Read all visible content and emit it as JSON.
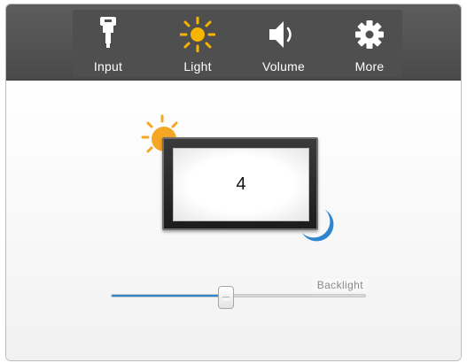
{
  "tabs": [
    {
      "label": "Input",
      "icon": "input-plug-icon"
    },
    {
      "label": "Light",
      "icon": "sun-icon"
    },
    {
      "label": "Volume",
      "icon": "speaker-icon"
    },
    {
      "label": "More",
      "icon": "gear-icon"
    }
  ],
  "active_tab": "Light",
  "monitor": {
    "value": "4"
  },
  "slider": {
    "label": "Backlight",
    "level": 0.45
  },
  "colors": {
    "toolbar": "#4f4f4f",
    "active_icon": "#f7b500",
    "inactive_icon": "#ffffff",
    "slider_fill": "#2f86d0",
    "moon": "#2f86d0",
    "sun": "#f5a623"
  }
}
